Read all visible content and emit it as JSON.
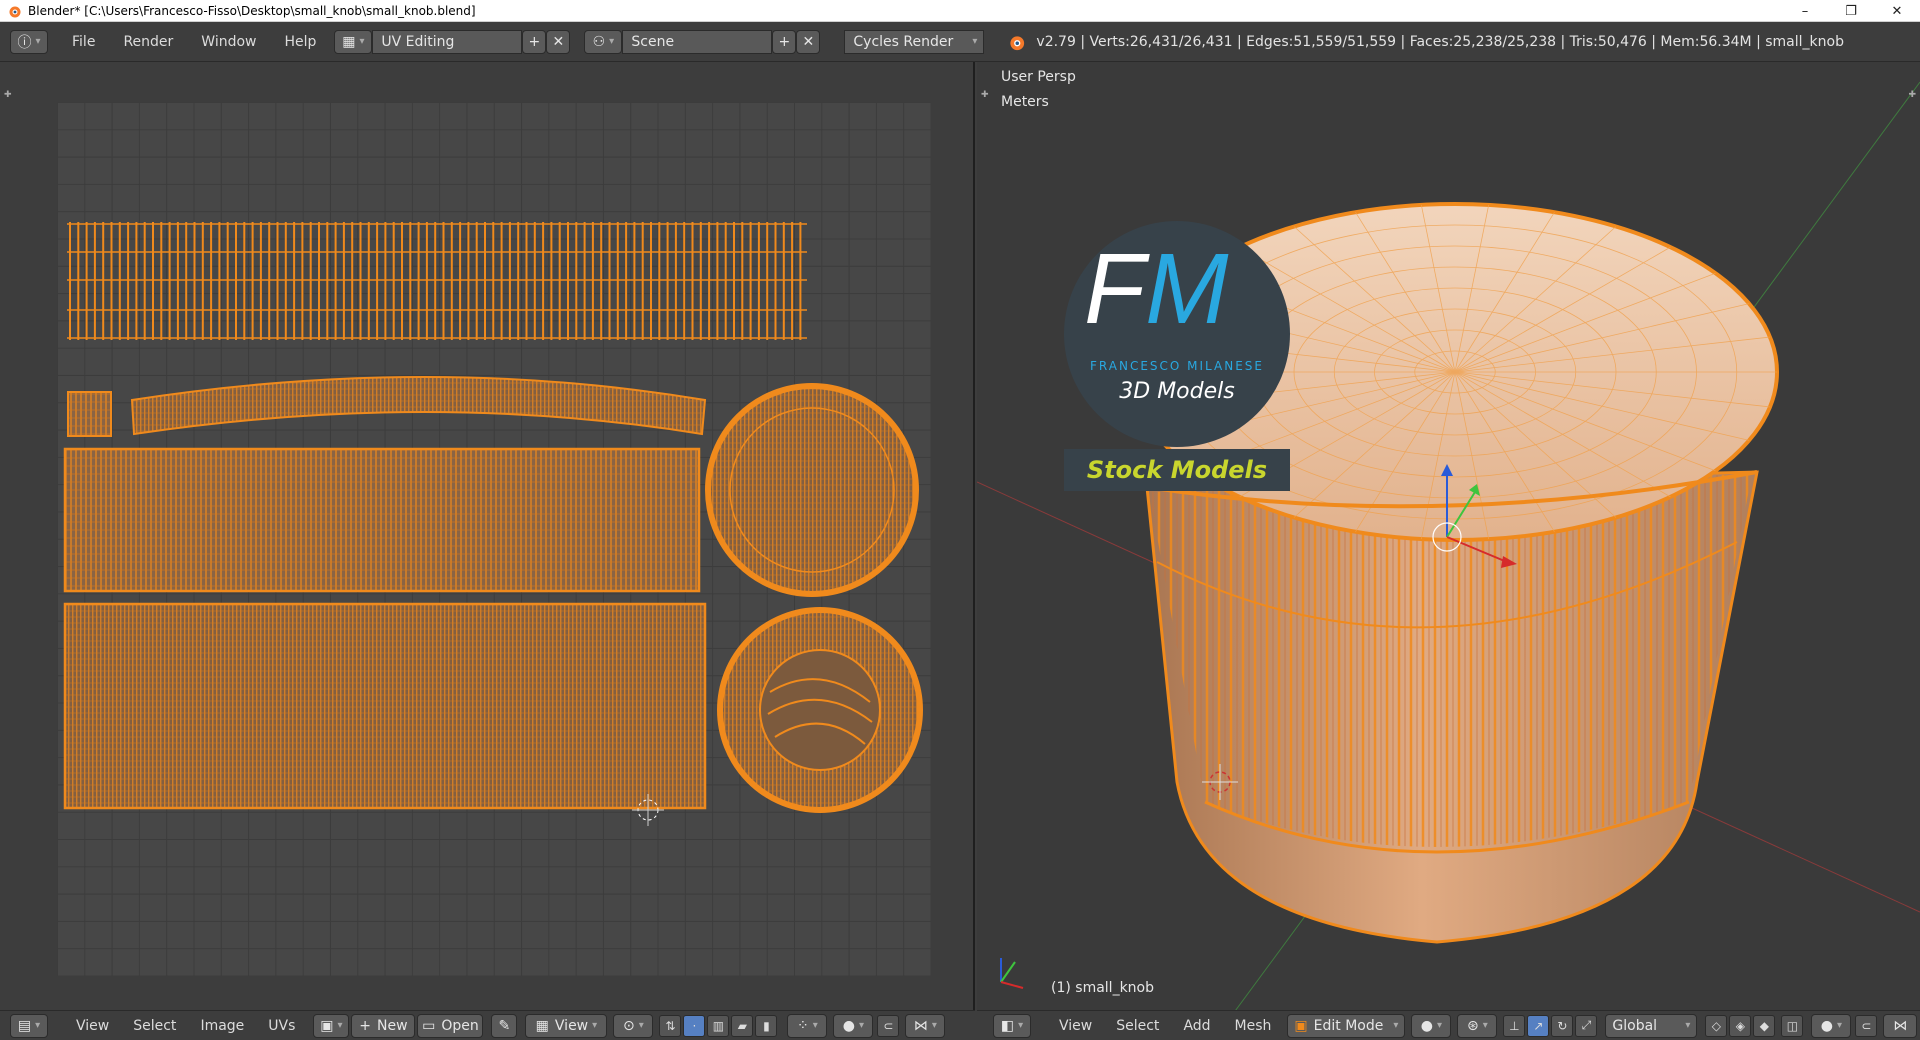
{
  "window": {
    "title": "Blender* [C:\\Users\\Francesco-Fisso\\Desktop\\small_knob\\small_knob.blend]",
    "controls": [
      "–",
      "❐",
      "✕"
    ]
  },
  "infobar": {
    "menus": [
      "File",
      "Render",
      "Window",
      "Help"
    ],
    "screen_layout": "UV Editing",
    "scene": "Scene",
    "render_engine": "Cycles Render",
    "stats": "v2.79 | Verts:26,431/26,431 | Edges:51,559/51,559 | Faces:25,238/25,238 | Tris:50,476 | Mem:56.34M | small_knob"
  },
  "viewport": {
    "view_name": "User Persp",
    "units": "Meters",
    "object_label": "(1) small_knob",
    "watermark": {
      "letters_f": "F",
      "letters_m": "M",
      "name": "FRANCESCO MILANESE",
      "subtitle": "3D Models",
      "banner": "Stock Models"
    }
  },
  "uv_footer": {
    "menus": [
      "View",
      "Select",
      "Image",
      "UVs"
    ],
    "new_label": "New",
    "open_label": "Open",
    "view_label": "View"
  },
  "vp_footer": {
    "menus": [
      "View",
      "Select",
      "Add",
      "Mesh"
    ],
    "mode": "Edit Mode",
    "orientation": "Global"
  },
  "colors": {
    "accent_orange": "#f08a1c",
    "mesh_fill": "#d9a27a",
    "background": "#3d3d3d"
  }
}
